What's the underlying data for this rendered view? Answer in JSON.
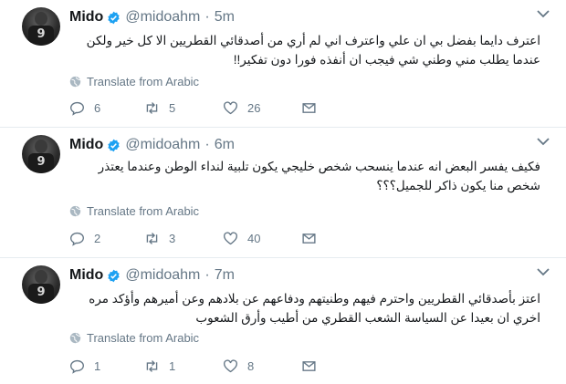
{
  "tweets": [
    {
      "name": "Mido",
      "handle": "@midoahm",
      "separator": "·",
      "time": "5m",
      "text": "اعترف دايما بفضل بي ان علي واعترف اني لم أري من أصدقائي القطريين الا كل خير ولكن عندما يطلب مني وطني شي فيجب ان أنفذه فورا دون تفكير!!",
      "translate_label": "Translate from Arabic",
      "replies": "6",
      "retweets": "5",
      "likes": "26"
    },
    {
      "name": "Mido",
      "handle": "@midoahm",
      "separator": "·",
      "time": "6m",
      "text": "فكيف يفسر البعض انه عندما ينسحب شخص خليجي يكون تلبية لنداء الوطن وعندما يعتذر شخص منا يكون ذاكر للجميل؟؟؟",
      "translate_label": "Translate from Arabic",
      "replies": "2",
      "retweets": "3",
      "likes": "40"
    },
    {
      "name": "Mido",
      "handle": "@midoahm",
      "separator": "·",
      "time": "7m",
      "text": "اعتز بأصدقائي القطريين واحترم فيهم وطنيتهم ودفاعهم عن بلادهم وعن أميرهم وأؤكد مره اخري ان بعيدا عن السياسة الشعب القطري من أطيب وأرق الشعوب",
      "translate_label": "Translate from Arabic",
      "replies": "1",
      "retweets": "1",
      "likes": "8"
    }
  ],
  "avatar_number": "9",
  "icons": {
    "verified": "verified-badge-icon",
    "caret": "chevron-down-icon",
    "translate": "globe-icon",
    "reply": "reply-icon",
    "retweet": "retweet-icon",
    "like": "heart-icon",
    "dm": "envelope-icon"
  },
  "colors": {
    "verified": "#1da1f2",
    "secondary_text": "#657786",
    "divider": "#e6ecf0"
  }
}
